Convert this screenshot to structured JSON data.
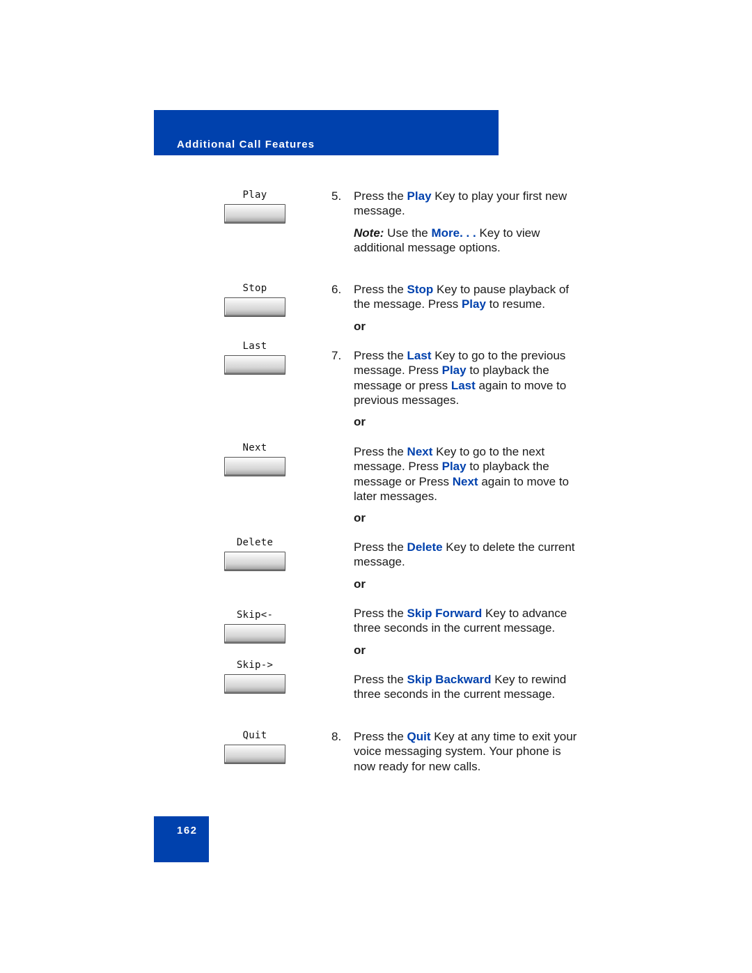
{
  "header": {
    "section_title": "Additional Call Features"
  },
  "page_number": "162",
  "colors": {
    "accent": "#0041ad",
    "keyword": "#0041ad",
    "text": "#1a1a1a"
  },
  "softkeys": [
    {
      "label": "Play"
    },
    {
      "label": "Stop"
    },
    {
      "label": "Last"
    },
    {
      "label": "Next"
    },
    {
      "label": "Delete"
    },
    {
      "label": "Skip<-"
    },
    {
      "label": "Skip->"
    },
    {
      "label": "Quit"
    }
  ],
  "steps": {
    "s5": {
      "num": "5.",
      "pre": "Press the ",
      "kw": "Play",
      "post": " Key to play your first new message."
    },
    "note": {
      "label": "Note:",
      "pre": " Use the ",
      "kw": "More. . .",
      "post": " Key to view additional message options."
    },
    "s6": {
      "num": "6.",
      "pre": "Press the ",
      "kw": "Stop",
      "mid": " Key to pause playback of the message. Press ",
      "kw2": "Play",
      "post": " to resume."
    },
    "s7": {
      "num": "7.",
      "pre": "Press the ",
      "kw": "Last",
      "mid": " Key to go to the previous message. Press ",
      "kw2": "Play",
      "mid2": " to playback the message or press ",
      "kw3": "Last",
      "post": " again to move to previous messages."
    },
    "next": {
      "pre": "Press the ",
      "kw": "Next",
      "mid": " Key to go to the next message. Press ",
      "kw2": "Play",
      "mid2": " to playback the message or Press ",
      "kw3": "Next",
      "post": " again to move to later messages."
    },
    "delete": {
      "pre": "Press the ",
      "kw": "Delete",
      "post": " Key to delete the current message."
    },
    "skipfwd": {
      "pre": "Press the ",
      "kw": "Skip Forward",
      "post": " Key to advance three seconds in the current message."
    },
    "skipback": {
      "pre": "Press the ",
      "kw": "Skip Backward",
      "post": " Key to rewind three seconds in the current message."
    },
    "s8": {
      "num": "8.",
      "pre": "Press the ",
      "kw": "Quit",
      "post": " Key at any time to exit your voice messaging system. Your phone is now ready for new calls."
    }
  },
  "or_label": "or"
}
